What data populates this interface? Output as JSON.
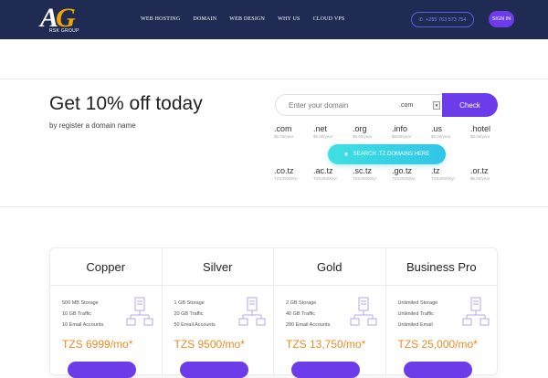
{
  "logo": {
    "mark_a": "A",
    "mark_g": "G",
    "tagline": "RSK GROUP"
  },
  "nav": {
    "items": [
      "WEB HOSTING",
      "DOMAIN",
      "WEB DESIGN",
      "WHY US",
      "CLOUD VPS"
    ],
    "phone": "+255 763 573 754",
    "signin": "SIGN IN"
  },
  "promo": {
    "title": "Get 10% off today",
    "subtitle": "by register a domain name"
  },
  "search": {
    "placeholder": "Enter your domain",
    "tld_selected": ".com",
    "check_label": "Check",
    "tz_label": "SEARCH .TZ DOMAINS HERE"
  },
  "tlds_row1": [
    {
      "name": ".com",
      "price": "$5.00/year"
    },
    {
      "name": ".net",
      "price": "$5.00/year"
    },
    {
      "name": ".org",
      "price": "$5.00/year"
    },
    {
      "name": ".info",
      "price": "$5.00/year"
    },
    {
      "name": ".us",
      "price": "$5.00/year"
    },
    {
      "name": ".hotel",
      "price": "$5.00/year"
    }
  ],
  "tlds_row2": [
    {
      "name": ".co.tz",
      "price": "TZS25000/yr"
    },
    {
      "name": ".ac.tz",
      "price": "TZS25000/yr"
    },
    {
      "name": ".sc.tz",
      "price": "TZS25000/yr"
    },
    {
      "name": ".go.tz",
      "price": "TZS25000/yr"
    },
    {
      "name": ".tz",
      "price": "TZS25000/yr"
    },
    {
      "name": ".or.tz",
      "price": "$5.00/year"
    }
  ],
  "plans": [
    {
      "name": "Copper",
      "features": [
        "500 MB Storage",
        "10 GB Traffic",
        "10 Email Accounts"
      ],
      "price": "TZS 6999/mo*"
    },
    {
      "name": "Silver",
      "features": [
        "1 GB Storage",
        "20 GB Traffic",
        "50 Email Accounts"
      ],
      "price": "TZS 9500/mo*"
    },
    {
      "name": "Gold",
      "features": [
        "2 GB Storage",
        "40 GB Traffic",
        "200 Email Accounts"
      ],
      "price": "TZS 13,750/mo*"
    },
    {
      "name": "Business Pro",
      "features": [
        "Unlimited Storage",
        "Unlimited Traffic",
        "Unlimited Email"
      ],
      "price": "TZS 25,000/mo*"
    }
  ],
  "colors": {
    "navbar": "#1f2b52",
    "accent_purple": "#6c3bea",
    "price_orange": "#f08a1e",
    "tz_button": "#3fe0e0"
  }
}
